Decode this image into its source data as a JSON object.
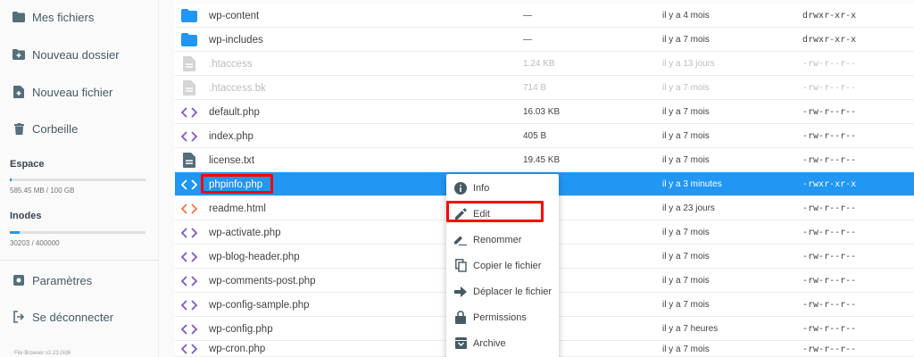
{
  "sidebar": {
    "items": [
      {
        "label": "Mes fichiers",
        "icon": "folder-icon"
      },
      {
        "label": "Nouveau dossier",
        "icon": "add-folder-icon"
      },
      {
        "label": "Nouveau fichier",
        "icon": "add-file-icon"
      },
      {
        "label": "Corbeille",
        "icon": "trash-icon"
      }
    ],
    "space": {
      "title": "Espace",
      "caption": "585.45 MB / 100 GB",
      "usage_percent": 0.6
    },
    "inodes": {
      "title": "Inodes",
      "caption": "30203 / 400000",
      "usage_percent": 7.5
    },
    "bottom_items": [
      {
        "label": "Paramètres",
        "icon": "settings-icon"
      },
      {
        "label": "Se déconnecter",
        "icon": "logout-icon"
      }
    ],
    "footer": "File Browser v2.23.0/d6"
  },
  "files": [
    {
      "name": "wp-content",
      "size": "—",
      "modified": "il y a 4 mois",
      "perm": "drwxr-xr-x",
      "type": "folder"
    },
    {
      "name": "wp-includes",
      "size": "—",
      "modified": "il y a 7 mois",
      "perm": "drwxr-xr-x",
      "type": "folder"
    },
    {
      "name": ".htaccess",
      "size": "1.24 KB",
      "modified": "il y a 13 jours",
      "perm": "-rw-r--r--",
      "type": "doc-hidden"
    },
    {
      "name": ".htaccess.bk",
      "size": "714 B",
      "modified": "il y a 7 mois",
      "perm": "-rw-r--r--",
      "type": "doc-hidden"
    },
    {
      "name": "default.php",
      "size": "16.03 KB",
      "modified": "il y a 7 mois",
      "perm": "-rw-r--r--",
      "type": "code"
    },
    {
      "name": "index.php",
      "size": "405 B",
      "modified": "il y a 7 mois",
      "perm": "-rw-r--r--",
      "type": "code"
    },
    {
      "name": "license.txt",
      "size": "19.45 KB",
      "modified": "il y a 7 mois",
      "perm": "-rw-r--r--",
      "type": "doc"
    },
    {
      "name": "phpinfo.php",
      "size": "",
      "modified": "il y a 3 minutes",
      "perm": "-rwxr-xr-x",
      "type": "code",
      "selected": true
    },
    {
      "name": "readme.html",
      "size": "",
      "modified": "il y a 23 jours",
      "perm": "-rw-r--r--",
      "type": "html"
    },
    {
      "name": "wp-activate.php",
      "size": "",
      "modified": "il y a 7 mois",
      "perm": "-rw-r--r--",
      "type": "code"
    },
    {
      "name": "wp-blog-header.php",
      "size": "",
      "modified": "il y a 7 mois",
      "perm": "-rw-r--r--",
      "type": "code"
    },
    {
      "name": "wp-comments-post.php",
      "size": "",
      "modified": "il y a 7 mois",
      "perm": "-rw-r--r--",
      "type": "code"
    },
    {
      "name": "wp-config-sample.php",
      "size": "",
      "modified": "il y a 7 mois",
      "perm": "-rw-r--r--",
      "type": "code"
    },
    {
      "name": "wp-config.php",
      "size": "",
      "modified": "il y a 7 heures",
      "perm": "-rw-r--r--",
      "type": "code"
    },
    {
      "name": "wp-cron.php",
      "size": "",
      "modified": "il y a 7 mois",
      "perm": "-rw-r--r--",
      "type": "code"
    }
  ],
  "context_menu": [
    {
      "label": "Info",
      "icon": "info-icon"
    },
    {
      "label": "Edit",
      "icon": "pencil-icon"
    },
    {
      "label": "Renommer",
      "icon": "rename-icon"
    },
    {
      "label": "Copier le fichier",
      "icon": "copy-icon"
    },
    {
      "label": "Déplacer le fichier",
      "icon": "move-icon"
    },
    {
      "label": "Permissions",
      "icon": "lock-icon"
    },
    {
      "label": "Archive",
      "icon": "archive-icon"
    }
  ],
  "colors": {
    "accent": "#2196f3",
    "highlight": "#ff0000",
    "code_icon": "#7e57c2",
    "html_icon": "#ff7043",
    "folder_icon": "#2196f3"
  }
}
